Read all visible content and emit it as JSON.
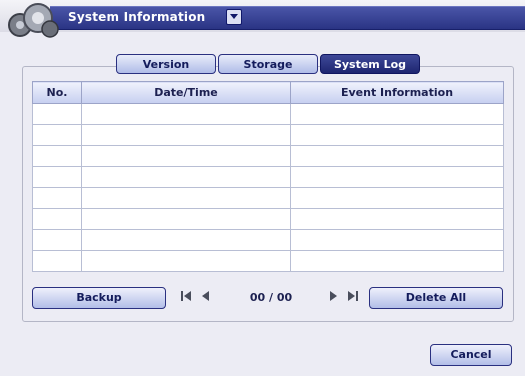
{
  "window": {
    "title": "System Information",
    "logo_icon": "gear-sphere-logo",
    "dropdown_icon": "chevron-down-icon"
  },
  "tabs": [
    {
      "label": "Version",
      "active": false
    },
    {
      "label": "Storage",
      "active": false
    },
    {
      "label": "System Log",
      "active": true
    }
  ],
  "table": {
    "columns": [
      "No.",
      "Date/Time",
      "Event Information"
    ],
    "rows": [
      [
        "",
        "",
        ""
      ],
      [
        "",
        "",
        ""
      ],
      [
        "",
        "",
        ""
      ],
      [
        "",
        "",
        ""
      ],
      [
        "",
        "",
        ""
      ],
      [
        "",
        "",
        ""
      ],
      [
        "",
        "",
        ""
      ],
      [
        "",
        "",
        ""
      ]
    ]
  },
  "pager": {
    "backup_label": "Backup",
    "page_text": "00 / 00",
    "first_icon": "skip-to-first-icon",
    "prev_icon": "previous-icon",
    "next_icon": "next-icon",
    "last_icon": "skip-to-last-icon",
    "delete_all_label": "Delete All"
  },
  "footer": {
    "cancel_label": "Cancel"
  },
  "colors": {
    "title_bar": "#2a3484",
    "active_tab": "#1e2670",
    "button_face": "#b2bee8",
    "table_header": "#c6cff0",
    "background": "#ececf4"
  }
}
